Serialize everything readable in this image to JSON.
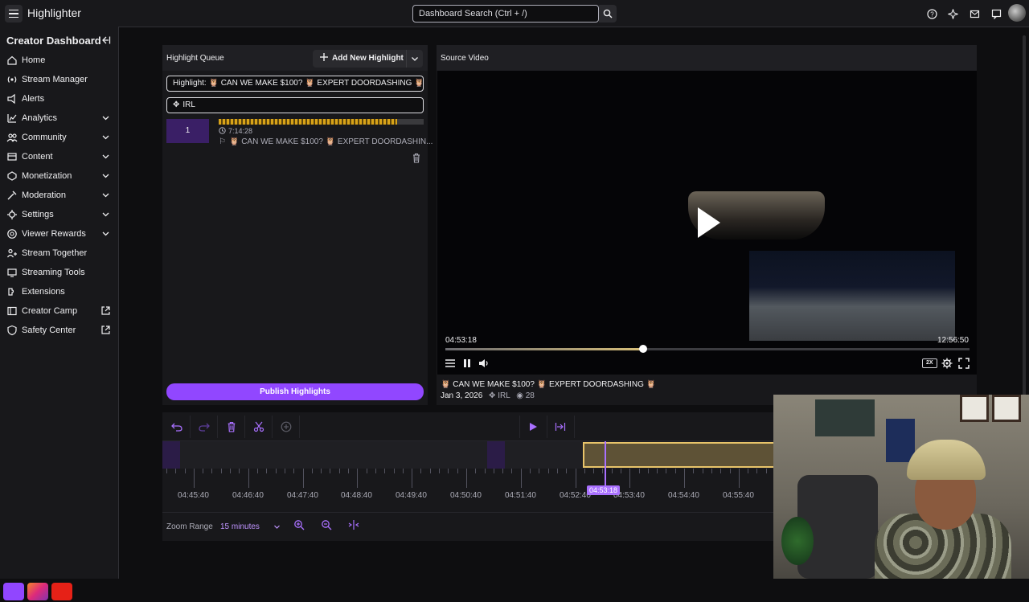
{
  "app": {
    "title": "Highlighter"
  },
  "search": {
    "placeholder": "Dashboard Search (Ctrl + /)"
  },
  "top_icons": [
    "help-icon",
    "sparkle-icon",
    "inbox-icon",
    "chat-icon"
  ],
  "sidebar": {
    "header": "Creator Dashboard",
    "items": [
      {
        "label": "Home",
        "icon": "home-icon",
        "chevron": false,
        "external": false
      },
      {
        "label": "Stream Manager",
        "icon": "stream-icon",
        "chevron": false,
        "external": false
      },
      {
        "label": "Alerts",
        "icon": "alert-icon",
        "chevron": false,
        "external": false
      },
      {
        "label": "Analytics",
        "icon": "analytics-icon",
        "chevron": true,
        "external": false
      },
      {
        "label": "Community",
        "icon": "community-icon",
        "chevron": true,
        "external": false
      },
      {
        "label": "Content",
        "icon": "content-icon",
        "chevron": true,
        "external": false
      },
      {
        "label": "Monetization",
        "icon": "monetization-icon",
        "chevron": true,
        "external": false
      },
      {
        "label": "Moderation",
        "icon": "moderation-icon",
        "chevron": true,
        "external": false
      },
      {
        "label": "Settings",
        "icon": "settings-icon",
        "chevron": true,
        "external": false
      },
      {
        "label": "Viewer Rewards",
        "icon": "rewards-icon",
        "chevron": true,
        "external": false
      },
      {
        "label": "Stream Together",
        "icon": "together-icon",
        "chevron": false,
        "external": false
      },
      {
        "label": "Streaming Tools",
        "icon": "tools-icon",
        "chevron": false,
        "external": false
      },
      {
        "label": "Extensions",
        "icon": "extensions-icon",
        "chevron": false,
        "external": false
      },
      {
        "label": "Creator Camp",
        "icon": "camp-icon",
        "chevron": false,
        "external": true
      },
      {
        "label": "Safety Center",
        "icon": "safety-icon",
        "chevron": false,
        "external": true
      }
    ]
  },
  "queue": {
    "title": "Highlight Queue",
    "add_label": "Add New Highlight",
    "title_field": "Highlight: 🦉 CAN WE MAKE $100? 🦉 EXPERT DOORDASHING 🦉",
    "category_field": "IRL",
    "item": {
      "number": "1",
      "duration": "7:14:28",
      "title": "🦉 CAN WE MAKE $100? 🦉 EXPERT DOORDASHIN..."
    },
    "publish_label": "Publish Highlights"
  },
  "video": {
    "title": "Source Video",
    "current_time": "04:53:18",
    "total_time": "12:56:50",
    "progress_fraction": 0.377,
    "speed_badge": "2X",
    "caption": "🦉 CAN WE MAKE $100? 🦉 EXPERT DOORDASHING 🦉",
    "date": "Jan 3, 2026",
    "category": "IRL",
    "views": "28"
  },
  "timeline": {
    "labels": [
      "04:45:40",
      "04:46:40",
      "04:47:40",
      "04:48:40",
      "04:49:40",
      "04:50:40",
      "04:51:40",
      "04:52:40",
      "04:53:40",
      "04:54:40",
      "04:55:40"
    ],
    "cursor_time": "04:53:18",
    "zoom_label": "Zoom Range",
    "zoom_value": "15 minutes"
  },
  "colors": {
    "accent": "#9147ff",
    "selection": "#e8c46a",
    "background": "#0e0e10",
    "panel": "#18181b"
  }
}
